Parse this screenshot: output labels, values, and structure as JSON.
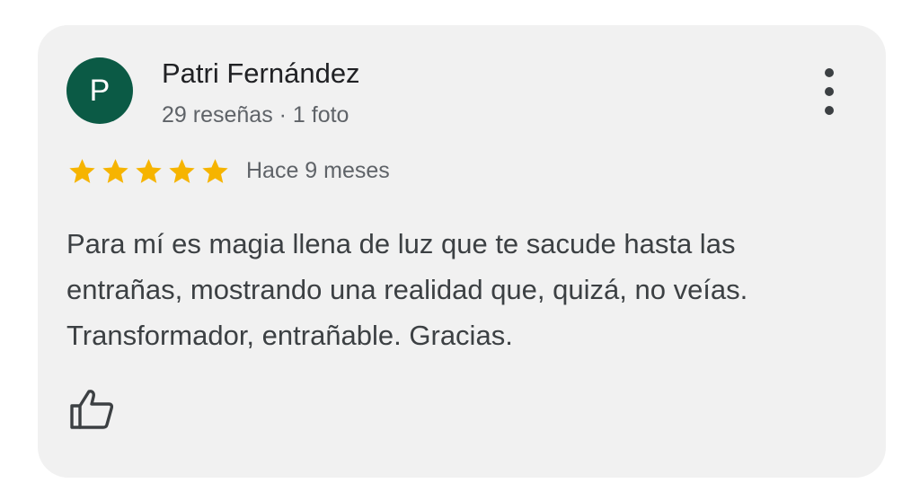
{
  "review": {
    "avatar_letter": "P",
    "avatar_color": "#0b5a45",
    "author_name": "Patri Fernández",
    "author_meta": "29 reseñas · 1 foto",
    "rating": 5,
    "rating_max": 5,
    "star_color": "#f6b400",
    "time_ago": "Hace 9 meses",
    "text": "Para mí es magia llena de luz que te sacude hasta las entrañas, mostrando una realidad que, quizá, no veías. Transformador, entrañable. Gracias."
  },
  "icons": {
    "menu": "more-vertical-icon",
    "like": "thumbs-up-icon",
    "star": "star-icon"
  }
}
